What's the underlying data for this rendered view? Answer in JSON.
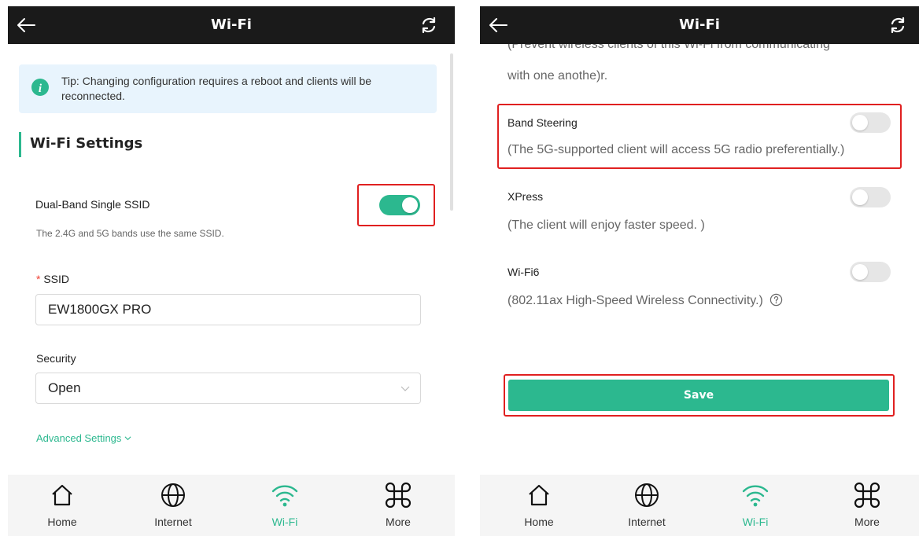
{
  "colors": {
    "accent": "#2cb88f",
    "header_bg": "#1a1a1a",
    "highlight": "#e02020"
  },
  "left": {
    "header": {
      "title": "Wi-Fi",
      "back_icon": "arrow-left-icon",
      "refresh_icon": "refresh-icon"
    },
    "tip": {
      "icon": "info-icon",
      "text": "Tip: Changing configuration requires a reboot and clients will be reconnected."
    },
    "section_title": "Wi-Fi Settings",
    "dual_band": {
      "label": "Dual-Band Single SSID",
      "hint": "The 2.4G and 5G bands use the same SSID.",
      "enabled": true
    },
    "ssid": {
      "required_mark": "*",
      "label": "SSID",
      "value": "EW1800GX PRO"
    },
    "security": {
      "label": "Security",
      "value": "Open"
    },
    "advanced": {
      "label": "Advanced Settings"
    }
  },
  "right": {
    "header": {
      "title": "Wi-Fi",
      "back_icon": "arrow-left-icon",
      "refresh_icon": "refresh-icon"
    },
    "cut_text_1": "(Prevent wireless clients of this Wi-Fi from communicating",
    "cut_text_2": "with one anothe)r.",
    "band_steering": {
      "label": "Band Steering",
      "desc": "(The 5G-supported client will access 5G radio preferentially.)",
      "enabled": false
    },
    "xpress": {
      "label": "XPress",
      "desc": "(The client will enjoy faster speed. )",
      "enabled": false
    },
    "wifi6": {
      "label": "Wi-Fi6",
      "desc": "(802.11ax High-Speed Wireless Connectivity.)",
      "enabled": false
    },
    "save_label": "Save"
  },
  "tabbar": {
    "tabs": [
      {
        "label": "Home",
        "icon": "home-icon",
        "active": false
      },
      {
        "label": "Internet",
        "icon": "globe-icon",
        "active": false
      },
      {
        "label": "Wi-Fi",
        "icon": "wifi-icon",
        "active": true
      },
      {
        "label": "More",
        "icon": "command-icon",
        "active": false
      }
    ]
  }
}
